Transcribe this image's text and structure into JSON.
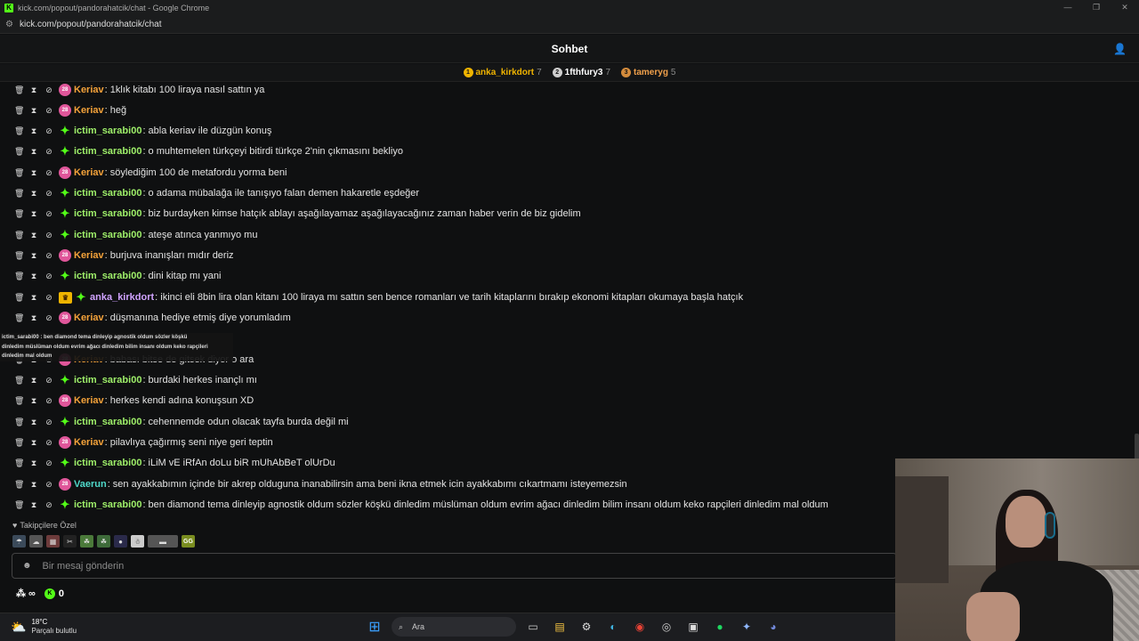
{
  "window": {
    "title": "kick.com/popout/pandorahatcik/chat - Google Chrome",
    "url": "kick.com/popout/pandorahatcik/chat"
  },
  "header": {
    "title": "Sohbet"
  },
  "leaderboard": [
    {
      "rank": "1",
      "name": "anka_kirkdort",
      "count": "7",
      "color": "#f0b400",
      "name_color": "#f0b400"
    },
    {
      "rank": "2",
      "name": "1fthfury3",
      "count": "7",
      "color": "#cfcfcf",
      "name_color": "#ffffff"
    },
    {
      "rank": "3",
      "name": "tameryg",
      "count": "5",
      "color": "#d38b3c",
      "name_color": "#f0a04b"
    }
  ],
  "messages": [
    {
      "user": "Keriav",
      "color": "#f4a23a",
      "badge": "sub",
      "text": ": 1klık kitabı 100 liraya nasıl sattın ya"
    },
    {
      "user": "Keriav",
      "color": "#f4a23a",
      "badge": "sub",
      "text": ": heğ"
    },
    {
      "user": "ictim_sarabi00",
      "color": "#9ff06a",
      "badge": "diamond",
      "text": ": abla keriav ile düzgün konuş"
    },
    {
      "user": "ictim_sarabi00",
      "color": "#9ff06a",
      "badge": "diamond",
      "text": ": o muhtemelen türkçeyi bitirdi türkçe 2'nin çıkmasını bekliyo"
    },
    {
      "user": "Keriav",
      "color": "#f4a23a",
      "badge": "sub",
      "text": ": söylediğim 100 de metafordu yorma beni"
    },
    {
      "user": "ictim_sarabi00",
      "color": "#9ff06a",
      "badge": "diamond",
      "text": ": o adama mübalağa ile tanışıyo falan demen hakaretle eşdeğer"
    },
    {
      "user": "ictim_sarabi00",
      "color": "#9ff06a",
      "badge": "diamond",
      "text": ": biz burdayken kimse hatçık ablayı aşağılayamaz aşağılayacağınız zaman haber verin de biz gidelim"
    },
    {
      "user": "ictim_sarabi00",
      "color": "#9ff06a",
      "badge": "diamond",
      "text": ": ateşe atınca yanmıyo mu"
    },
    {
      "user": "Keriav",
      "color": "#f4a23a",
      "badge": "sub",
      "text": ": burjuva inanışları mıdır deriz"
    },
    {
      "user": "ictim_sarabi00",
      "color": "#9ff06a",
      "badge": "diamond",
      "text": ": dini kitap mı yani"
    },
    {
      "user": "anka_kirkdort",
      "color": "#d0a3ff",
      "badge": "crown",
      "text": ": ikinci eli 8bin lira olan kitanı 100 liraya mı sattın sen bence romanları ve tarih kitaplarını bırakıp ekonomi kitapları okumaya başla hatçık"
    },
    {
      "user": "Keriav",
      "color": "#f4a23a",
      "badge": "sub",
      "text": ": düşmanına hediye etmiş diye yorumladım"
    },
    {
      "user": "Keriav",
      "color": "#f4a23a",
      "badge": "sub",
      "text": ": babası bitse de gitsek diyor o ara"
    },
    {
      "user": "ictim_sarabi00",
      "color": "#9ff06a",
      "badge": "diamond",
      "text": ": burdaki herkes inançlı mı"
    },
    {
      "user": "Keriav",
      "color": "#f4a23a",
      "badge": "sub",
      "text": ": herkes kendi adına konuşsun XD"
    },
    {
      "user": "ictim_sarabi00",
      "color": "#9ff06a",
      "badge": "diamond",
      "text": ": cehennemde odun olacak tayfa burda değil mi"
    },
    {
      "user": "Keriav",
      "color": "#f4a23a",
      "badge": "sub",
      "text": ": pilavlıya çağırmış seni niye geri teptin"
    },
    {
      "user": "ictim_sarabi00",
      "color": "#9ff06a",
      "badge": "diamond",
      "text": ": iLiM vE iRfAn doLu biR mUhAbBeT olUrDu"
    },
    {
      "user": "Vaerun",
      "color": "#4fd8c9",
      "badge": "sub",
      "text": ": sen ayakkabımın içinde bir akrep olduguna inanabilirsin ama beni ikna etmek icin ayakkabımı cıkartmamı isteyemezsin"
    },
    {
      "user": "ictim_sarabi00",
      "color": "#9ff06a",
      "badge": "diamond",
      "text": ": ben diamond tema dinleyip agnostik oldum sözler köşkü dinledim müslüman oldum evrim ağacı dinledim bilim insanı oldum keko rapçileri dinledim mal oldum"
    }
  ],
  "tooltip": {
    "line1": "ictim_sarabi00 : ben diamond tema dinleyip agnostik oldum sözler köşkü",
    "line2": "dinledim müslüman oldum evrim ağacı dinledim bilim insanı oldum keko rapçileri",
    "line3": "dinledim mal oldum"
  },
  "followers_label": "Takipçilere Özel",
  "emotes": [
    "emote-1",
    "emote-2",
    "emote-3",
    "emote-4",
    "emote-5",
    "emote-6",
    "emote-7",
    "emote-8",
    "emote-9",
    "emote-gg"
  ],
  "emote_gg_label": "GG",
  "input": {
    "placeholder": "Bir mesaj gönderin"
  },
  "bottom": {
    "infinity": "∞",
    "kicks": "0"
  },
  "taskbar": {
    "temperature": "18°C",
    "condition": "Parçalı bulutlu",
    "search_label": "Ara"
  },
  "colors": {
    "kick_green": "#53fc18",
    "background": "#0f1011"
  }
}
